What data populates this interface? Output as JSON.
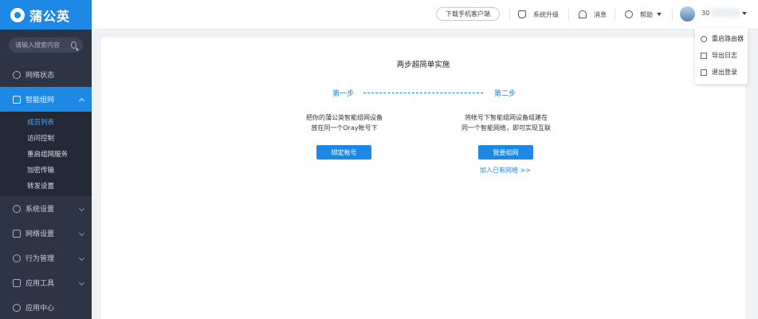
{
  "brand": {
    "name": "蒲公英"
  },
  "search": {
    "placeholder": "请输入搜索内容"
  },
  "sidebar": {
    "items": [
      {
        "label": "网络状态",
        "icon": "network-status-icon"
      },
      {
        "label": "智能组网",
        "icon": "smart-network-icon",
        "active": true
      },
      {
        "label": "系统设置",
        "icon": "system-settings-icon"
      },
      {
        "label": "网络设置",
        "icon": "network-settings-icon"
      },
      {
        "label": "行为管理",
        "icon": "behavior-management-icon"
      },
      {
        "label": "应用工具",
        "icon": "app-tools-icon"
      },
      {
        "label": "应用中心",
        "icon": "app-center-icon"
      }
    ],
    "sub_items": [
      "成员列表",
      "访问控制",
      "重启组网服务",
      "加密传输",
      "转发设置"
    ]
  },
  "topbar": {
    "download_label": "下载手机客户端",
    "upgrade_label": "系统升级",
    "messages_label": "消息",
    "help_label": "帮助",
    "username": "30"
  },
  "main": {
    "title": "两步超简单实施",
    "step1": {
      "label": "第一步",
      "desc_line1": "把你的蒲公英智能组网设备",
      "desc_line2": "放在同一个Oray帐号下",
      "button": "绑定帐号"
    },
    "step2": {
      "label": "第二步",
      "desc_line1": "将帐号下智能组网设备组建在",
      "desc_line2": "同一个智能网络，即可实现互联",
      "button": "我要组网",
      "link": "加入已有网络 >>"
    }
  },
  "user_menu": {
    "items": [
      {
        "label": "重启路由器",
        "icon": "restart-icon"
      },
      {
        "label": "导出日志",
        "icon": "export-log-icon"
      },
      {
        "label": "退出登录",
        "icon": "logout-icon"
      }
    ]
  },
  "colors": {
    "accent": "#1e88e5",
    "sidebar_bg": "#2d3443"
  }
}
